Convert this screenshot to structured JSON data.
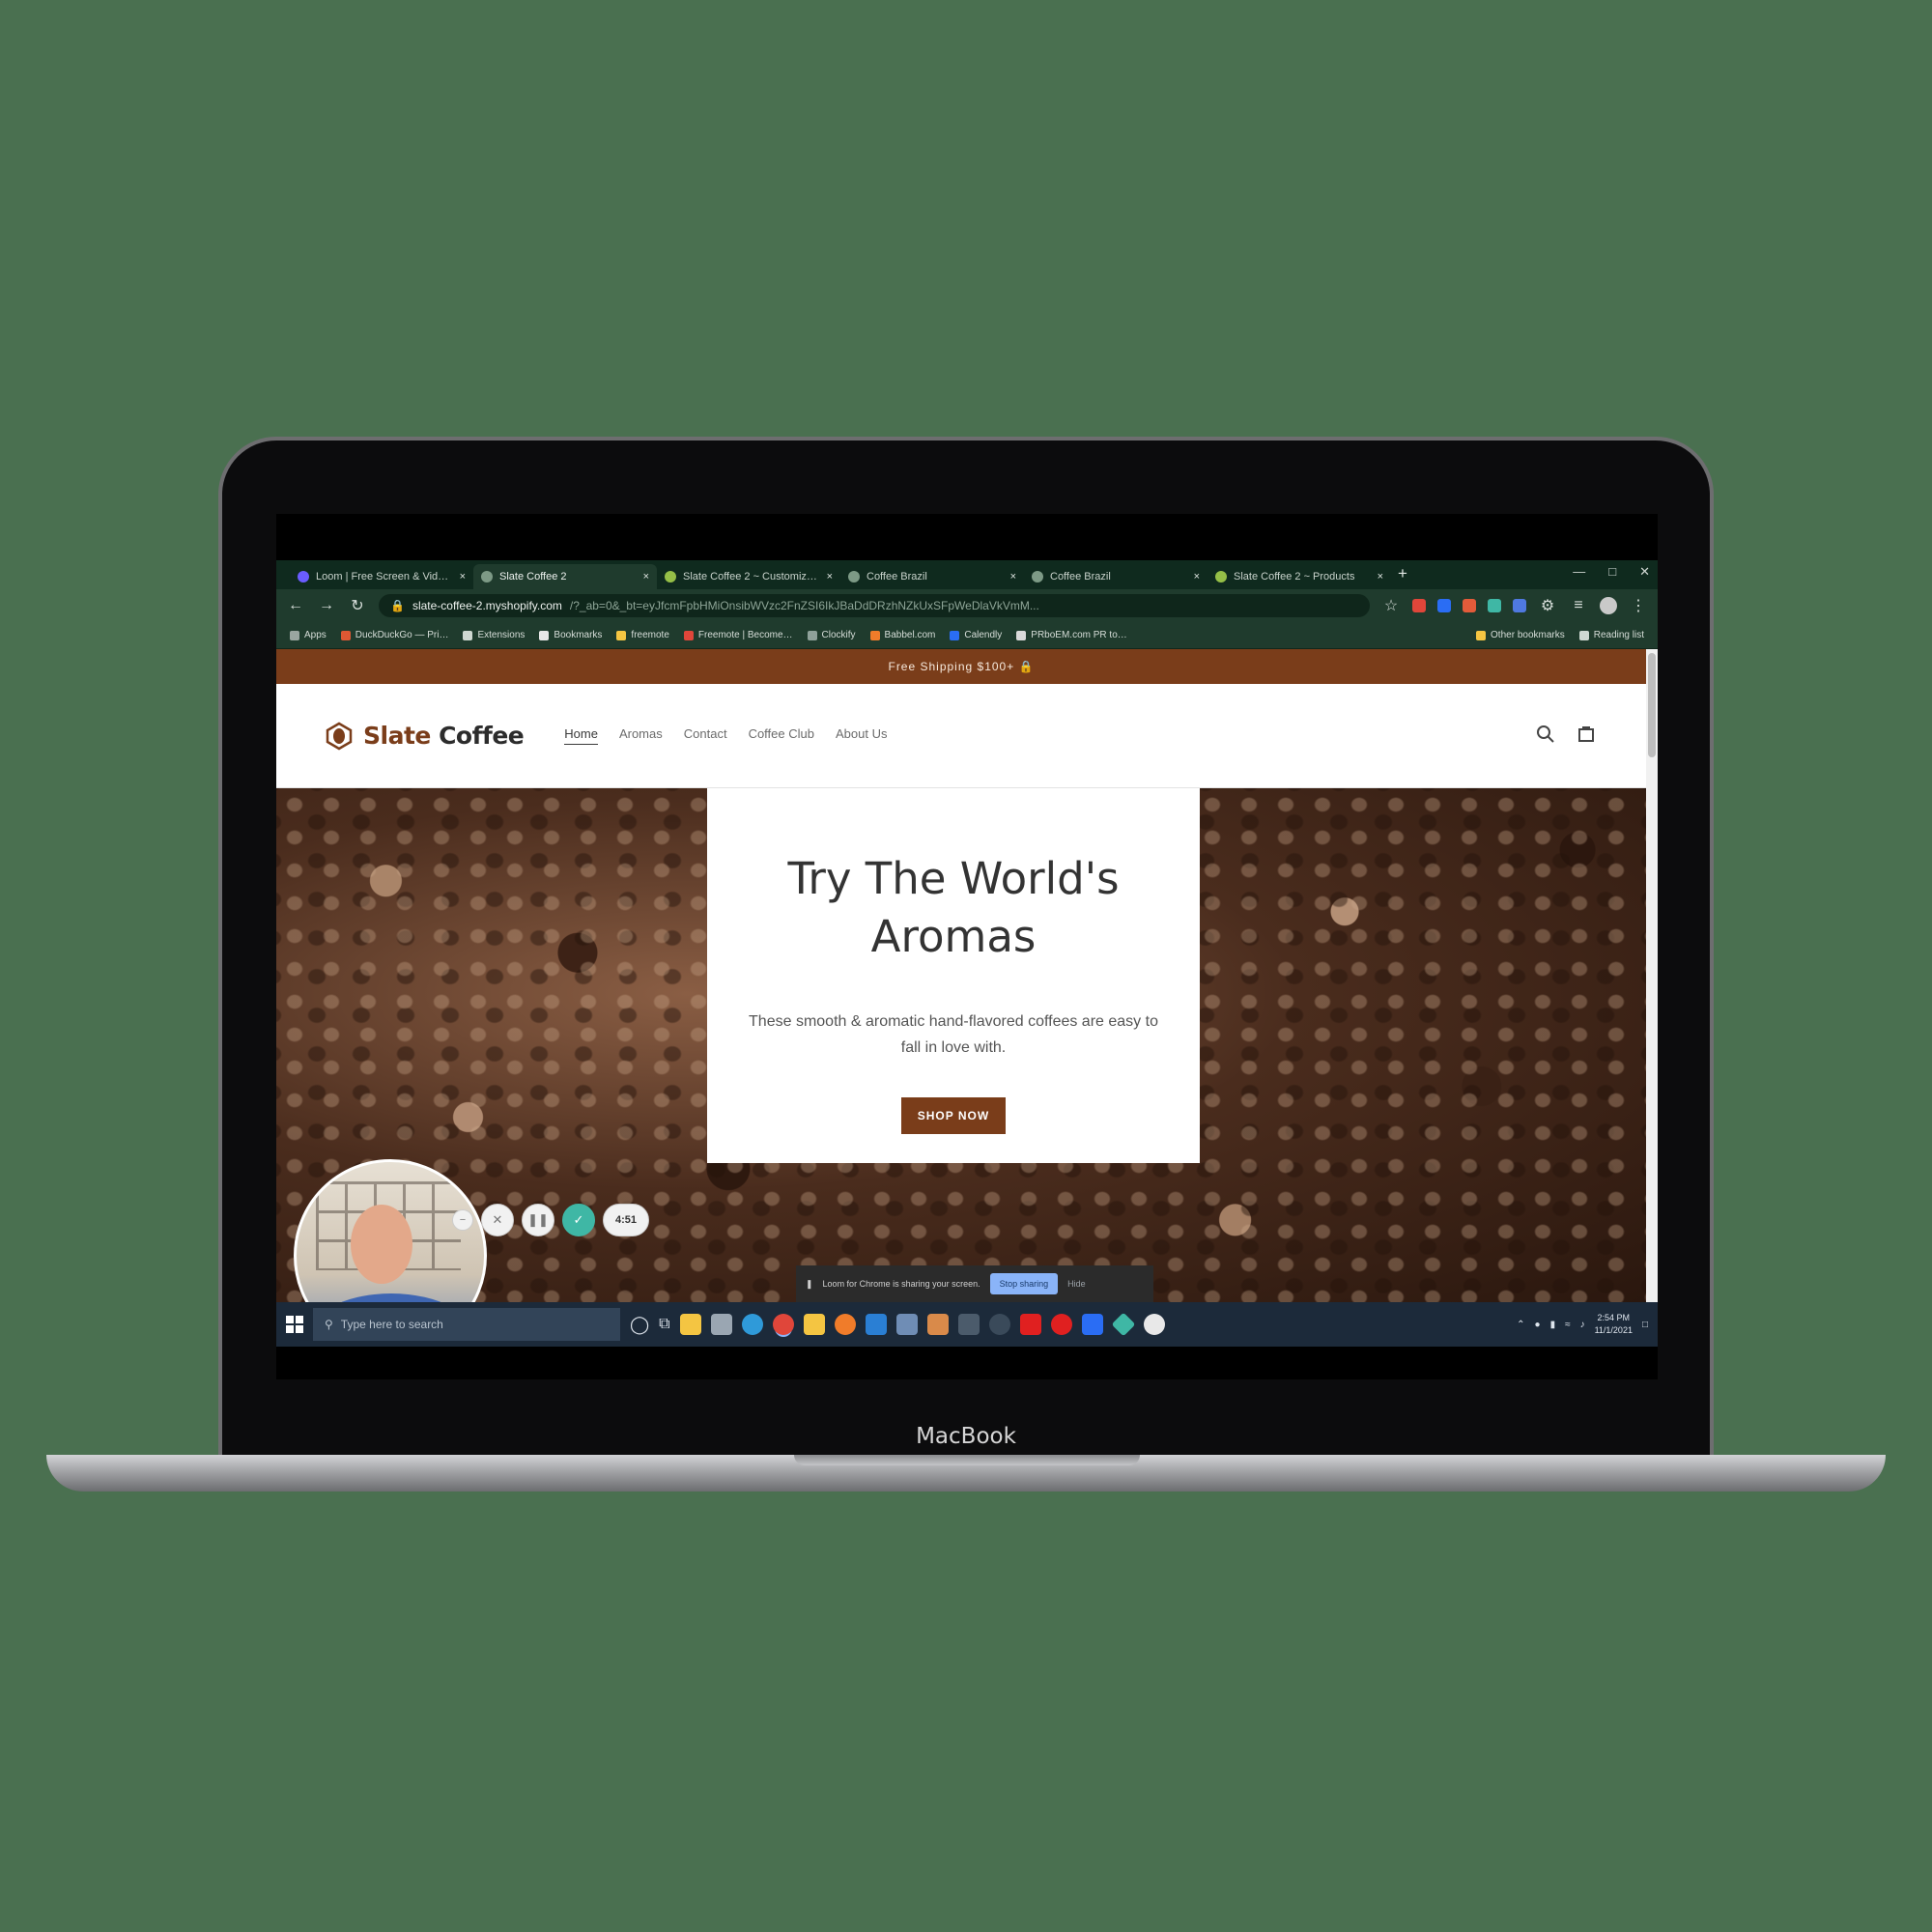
{
  "device": {
    "brand_label": "MacBook"
  },
  "browser": {
    "tabs": [
      {
        "title": "Loom | Free Screen & Vid…",
        "active": false
      },
      {
        "title": "Slate Coffee 2",
        "active": true
      },
      {
        "title": "Slate Coffee 2 ~ Customiz…",
        "active": false
      },
      {
        "title": "Coffee Brazil",
        "active": false
      },
      {
        "title": "Coffee Brazil",
        "active": false
      },
      {
        "title": "Slate Coffee 2 ~ Products",
        "active": false
      }
    ],
    "tab_close": "×",
    "new_tab": "+",
    "url_host": "slate-coffee-2.myshopify.com",
    "url_rest": "/?_ab=0&_bt=eyJfcmFpbHMiOnsibWVzc2FnZSI6IkJBaDdDRzhNZkUxSFpWeDlaVkVmM...",
    "bookmarks": [
      {
        "label": "Apps",
        "color": "#9aa6a0"
      },
      {
        "label": "DuckDuckGo — Pri…",
        "color": "#de5833"
      },
      {
        "label": "Extensions",
        "color": "#cfd8d2"
      },
      {
        "label": "Bookmarks",
        "color": "#e8e8e8"
      },
      {
        "label": "freemote",
        "color": "#f4c542"
      },
      {
        "label": "Freemote | Become…",
        "color": "#e0463a"
      },
      {
        "label": "Clockify",
        "color": "#8fa19a"
      },
      {
        "label": "Babbel.com",
        "color": "#f07c2a"
      },
      {
        "label": "Calendly",
        "color": "#2a6df4"
      },
      {
        "label": "PRboEM.com PR to…",
        "color": "#d9d9d9"
      }
    ],
    "bookmarks_right": [
      {
        "label": "Other bookmarks",
        "color": "#f4c542"
      },
      {
        "label": "Reading list",
        "color": "#cfd8d2"
      }
    ]
  },
  "site": {
    "announcement": "Free Shipping $100+ 🔒",
    "logo": {
      "word1": "Slate",
      "word2": "Coffee"
    },
    "nav": [
      "Home",
      "Aromas",
      "Contact",
      "Coffee Club",
      "About Us"
    ],
    "hero": {
      "title_line1": "Try The World's",
      "title_line2": "Aromas",
      "subtitle": "These smooth & aromatic hand-flavored coffees are easy to fall in love with.",
      "cta": "SHOP NOW"
    }
  },
  "loom": {
    "timer": "4:51",
    "share_text": "Loom for Chrome is sharing your screen.",
    "stop_label": "Stop sharing",
    "hide_label": "Hide"
  },
  "taskbar": {
    "search_placeholder": "Type here to search",
    "time": "2:54 PM",
    "date": "11/1/2021"
  },
  "colors": {
    "brand_brown": "#7a3d1a",
    "browser_dark": "#0f2a1e",
    "taskbar": "#1c2a3a",
    "background": "#4a7050"
  }
}
